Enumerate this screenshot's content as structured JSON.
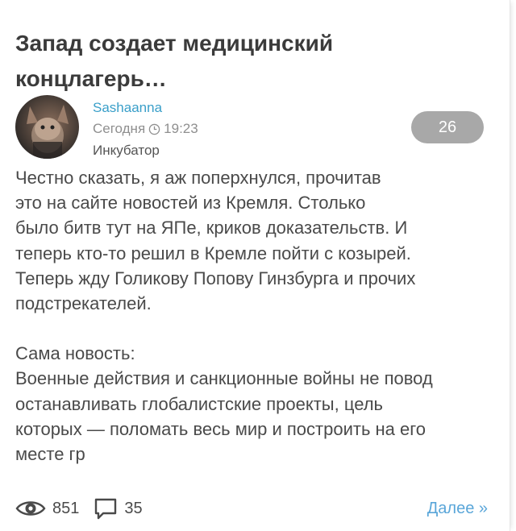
{
  "post": {
    "title": "Запад создает медицинский концлагерь…",
    "author": "Sashaanna",
    "date": "Сегодня",
    "time": "19:23",
    "category": "Инкубатор",
    "rating": "26",
    "paragraphs": [
      "Честно сказать, я аж поперхнулся, прочитав\nэто на сайте новостей из Кремля. Столько\nбыло битв тут на ЯПе, криков доказательств. И\nтеперь кто-то решил в Кремле пойти с козырей.\nТеперь жду Голикову Попову Гинзбурга и прочих\nподстрекателей.",
      "Сама новость:\nВоенные действия и санкционные войны не повод\nостанавливать глобалистские проекты, цель\nкоторых — поломать весь мир и построить на его\nместе гр"
    ],
    "views": "851",
    "comments": "35",
    "more_label": "Далее »"
  },
  "icons": {
    "avatar": "avatar-image",
    "clock": "clock-icon",
    "views": "eye-icon",
    "comments": "comment-icon"
  },
  "colors": {
    "author": "#3a9fc9",
    "more_link": "#5aa6d9",
    "rating_badge": "#a8a8a8",
    "title": "#3b3b3b"
  }
}
